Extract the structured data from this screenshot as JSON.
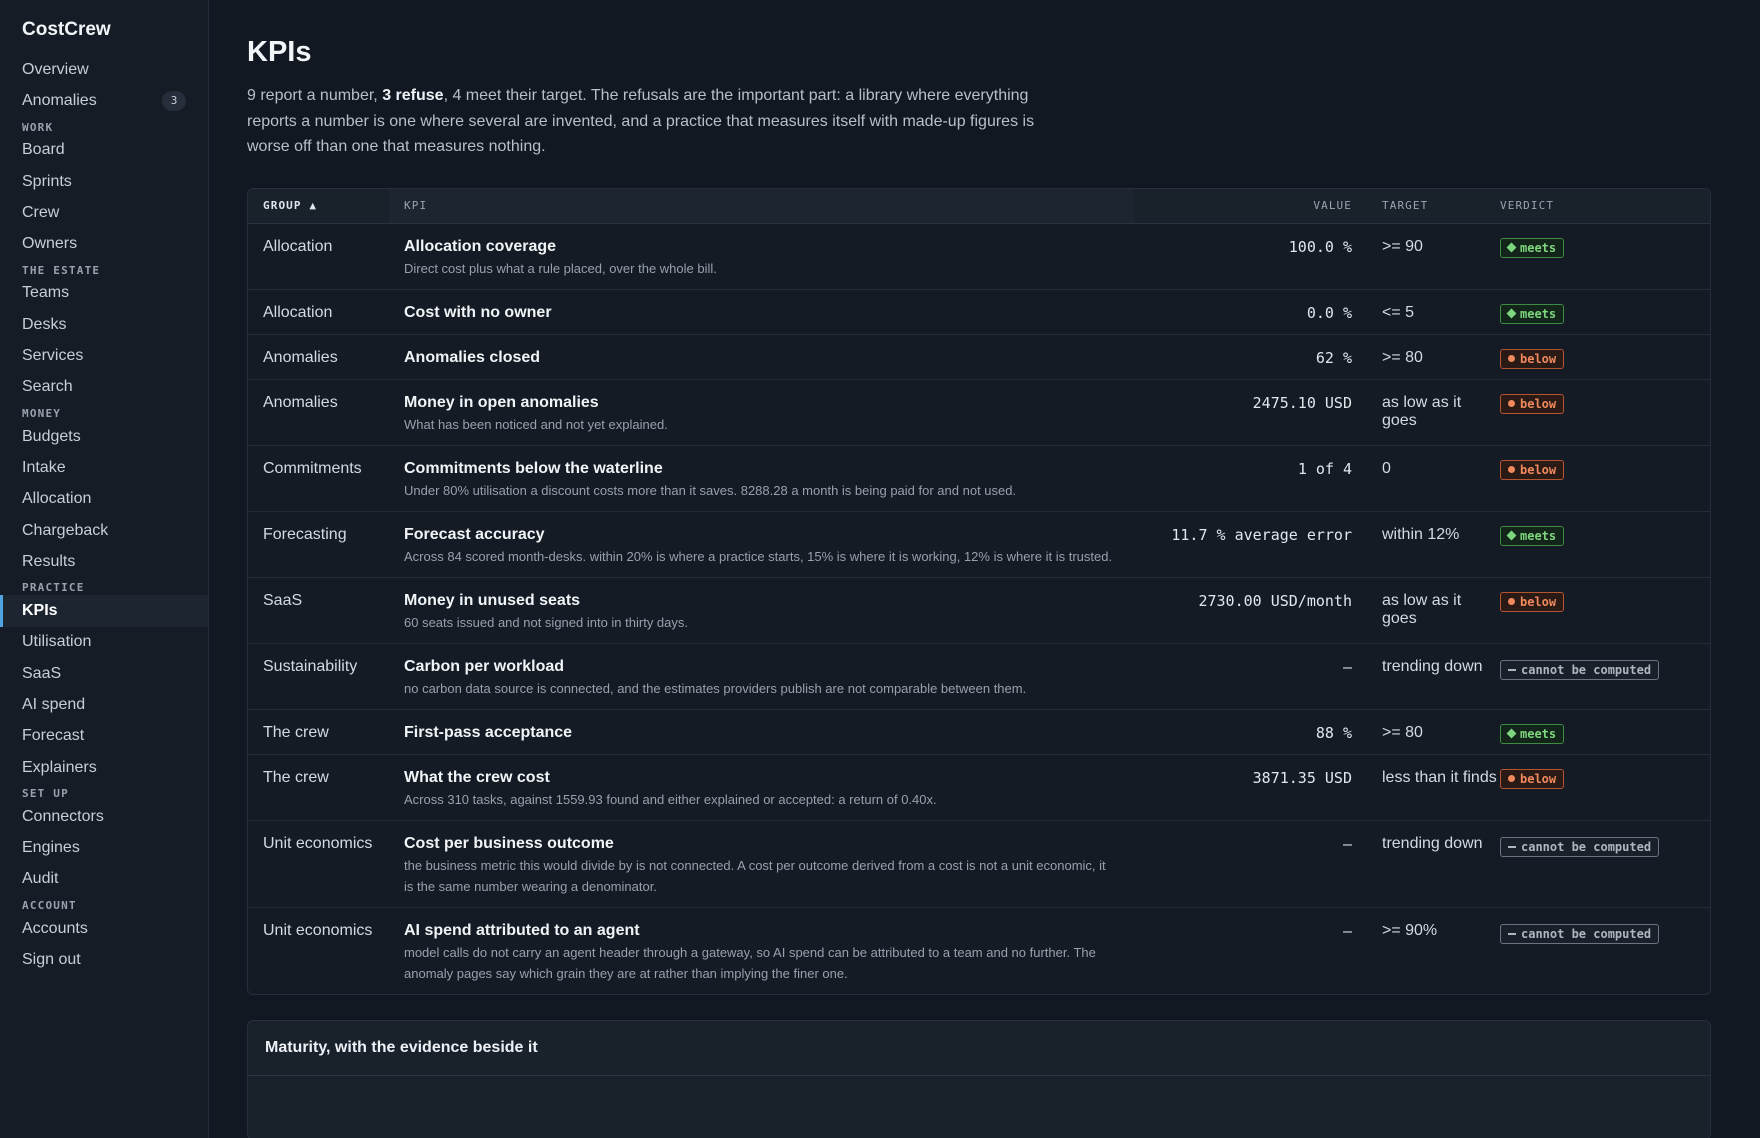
{
  "app": {
    "name": "CostCrew"
  },
  "sidebar": {
    "top_items": [
      {
        "label": "Overview"
      },
      {
        "label": "Anomalies",
        "badge": "3"
      }
    ],
    "sections": [
      {
        "title": "WORK",
        "items": [
          {
            "label": "Board"
          },
          {
            "label": "Sprints"
          },
          {
            "label": "Crew"
          },
          {
            "label": "Owners"
          }
        ]
      },
      {
        "title": "THE ESTATE",
        "items": [
          {
            "label": "Teams"
          },
          {
            "label": "Desks"
          },
          {
            "label": "Services"
          },
          {
            "label": "Search"
          }
        ]
      },
      {
        "title": "MONEY",
        "items": [
          {
            "label": "Budgets"
          },
          {
            "label": "Intake"
          },
          {
            "label": "Allocation"
          },
          {
            "label": "Chargeback"
          },
          {
            "label": "Results"
          }
        ]
      },
      {
        "title": "PRACTICE",
        "items": [
          {
            "label": "KPIs",
            "active": true
          },
          {
            "label": "Utilisation"
          },
          {
            "label": "SaaS"
          },
          {
            "label": "AI spend"
          },
          {
            "label": "Forecast"
          },
          {
            "label": "Explainers"
          }
        ]
      },
      {
        "title": "SET UP",
        "items": [
          {
            "label": "Connectors"
          },
          {
            "label": "Engines"
          },
          {
            "label": "Audit"
          }
        ]
      },
      {
        "title": "ACCOUNT",
        "items": [
          {
            "label": "Accounts"
          },
          {
            "label": "Sign out"
          }
        ]
      }
    ]
  },
  "page": {
    "title": "KPIs",
    "intro_before": "9 report a number, ",
    "intro_bold": "3 refuse",
    "intro_after": ", 4 meet their target. The refusals are the important part: a library where everything reports a number is one where several are invented, and a practice that measures itself with made-up figures is worse off than one that measures nothing."
  },
  "table": {
    "headers": {
      "group": "GROUP ▲",
      "kpi": "KPI",
      "value": "VALUE",
      "target": "TARGET",
      "verdict": "VERDICT"
    },
    "rows": [
      {
        "group": "Allocation",
        "name": "Allocation coverage",
        "desc": "Direct cost plus what a rule placed, over the whole bill.",
        "value": "100.0 %",
        "target": ">= 90",
        "verdict": "meets"
      },
      {
        "group": "Allocation",
        "name": "Cost with no owner",
        "desc": "",
        "value": "0.0 %",
        "target": "<= 5",
        "verdict": "meets"
      },
      {
        "group": "Anomalies",
        "name": "Anomalies closed",
        "desc": "",
        "value": "62 %",
        "target": ">= 80",
        "verdict": "below"
      },
      {
        "group": "Anomalies",
        "name": "Money in open anomalies",
        "desc": "What has been noticed and not yet explained.",
        "value": "2475.10 USD",
        "target": "as low as it goes",
        "verdict": "below"
      },
      {
        "group": "Commitments",
        "name": "Commitments below the waterline",
        "desc": "Under 80% utilisation a discount costs more than it saves. 8288.28 a month is being paid for and not used.",
        "value": "1 of 4",
        "target": "0",
        "verdict": "below"
      },
      {
        "group": "Forecasting",
        "name": "Forecast accuracy",
        "desc": "Across 84 scored month-desks. within 20% is where a practice starts, 15% is where it is working, 12% is where it is trusted.",
        "value": "11.7 % average error",
        "target": "within 12%",
        "verdict": "meets"
      },
      {
        "group": "SaaS",
        "name": "Money in unused seats",
        "desc": "60 seats issued and not signed into in thirty days.",
        "value": "2730.00 USD/month",
        "target": "as low as it goes",
        "verdict": "below"
      },
      {
        "group": "Sustainability",
        "name": "Carbon per workload",
        "desc": "no carbon data source is connected, and the estimates providers publish are not comparable between them.",
        "value": "—",
        "target": "trending down",
        "verdict": "cannot be computed"
      },
      {
        "group": "The crew",
        "name": "First-pass acceptance",
        "desc": "",
        "value": "88 %",
        "target": ">= 80",
        "verdict": "meets"
      },
      {
        "group": "The crew",
        "name": "What the crew cost",
        "desc": "Across 310 tasks, against 1559.93 found and either explained or accepted: a return of 0.40x.",
        "value": "3871.35 USD",
        "target": "less than it finds",
        "verdict": "below"
      },
      {
        "group": "Unit economics",
        "name": "Cost per business outcome",
        "desc": "the business metric this would divide by is not connected. A cost per outcome derived from a cost is not a unit economic, it is the same number wearing a denominator.",
        "value": "—",
        "target": "trending down",
        "verdict": "cannot be computed"
      },
      {
        "group": "Unit economics",
        "name": "AI spend attributed to an agent",
        "desc": "model calls do not carry an agent header through a gateway, so AI spend can be attributed to a team and no further. The anomaly pages say which grain they are at rather than implying the finer one.",
        "value": "—",
        "target": ">= 90%",
        "verdict": "cannot be computed"
      }
    ]
  },
  "panel": {
    "title": "Maturity, with the evidence beside it"
  }
}
